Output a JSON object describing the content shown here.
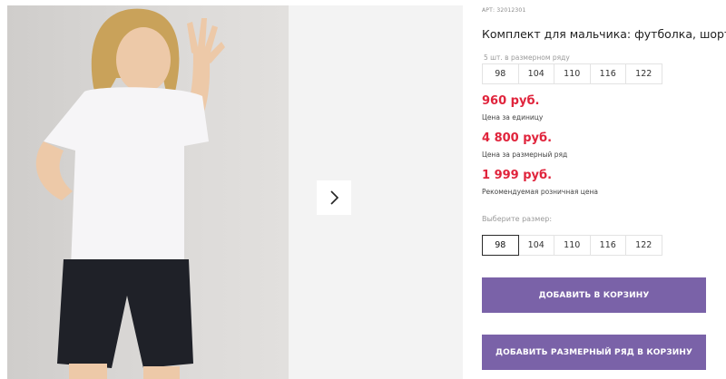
{
  "product": {
    "sku": "АРТ: 32012301",
    "title": "Комплект для мальчика: футболка, шорты"
  },
  "size_range": {
    "note": "5 шт. в размерном ряду",
    "sizes": [
      "98",
      "104",
      "110",
      "116",
      "122"
    ]
  },
  "prices": [
    {
      "value": "960 руб.",
      "label": "Цена за единицу"
    },
    {
      "value": "4 800 руб.",
      "label": "Цена за размерный ряд"
    },
    {
      "value": "1 999 руб.",
      "label": "Рекомендуемая розничная цена"
    }
  ],
  "size_picker": {
    "label": "Выберите размер:",
    "sizes": [
      "98",
      "104",
      "110",
      "116",
      "122"
    ],
    "selected": "98"
  },
  "actions": {
    "add_to_cart": "ДОБАВИТЬ В КОРЗИНУ",
    "add_range_to_cart": "ДОБАВИТЬ РАЗМЕРНЫЙ РЯД В КОРЗИНУ"
  },
  "gallery": {
    "next_icon": "chevron-right-icon"
  },
  "colors": {
    "price": "#e0243c",
    "button": "#7a62a8",
    "button_text": "#ffffff"
  }
}
